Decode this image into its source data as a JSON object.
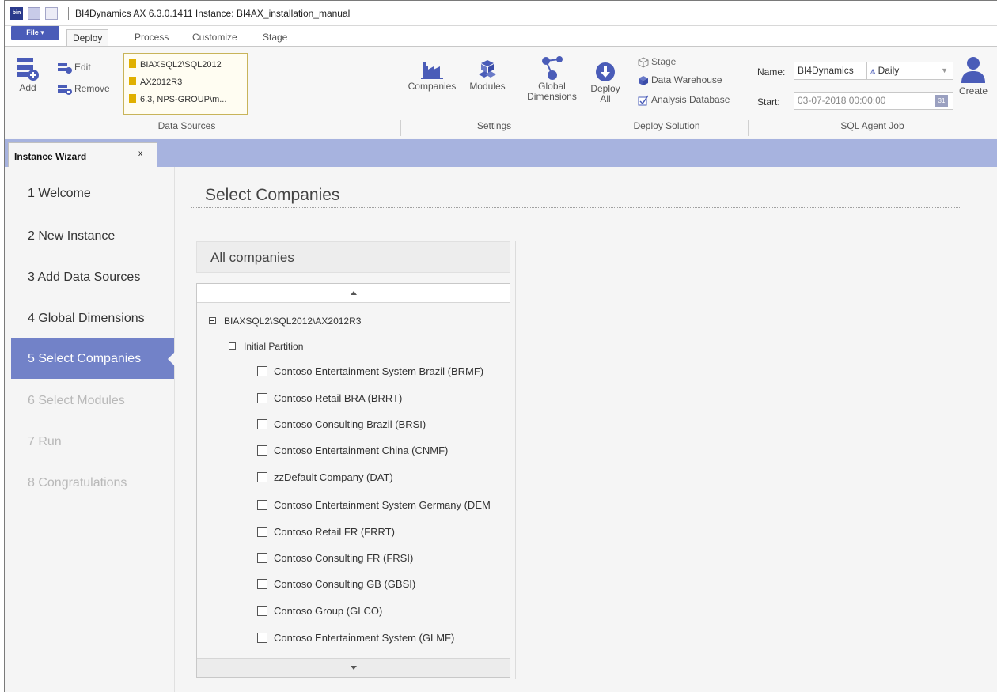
{
  "titlebar": {
    "title": "BI4Dynamics AX 6.3.0.1411  Instance: BI4AX_installation_manual",
    "app_icon_text": "bin"
  },
  "ribbon_tabs": {
    "file": "File ▾",
    "tabs": [
      {
        "label": "Deploy",
        "active": true
      },
      {
        "label": "Process"
      },
      {
        "label": "Customize"
      },
      {
        "label": "Stage"
      }
    ]
  },
  "ribbon": {
    "data_sources": {
      "add": "Add",
      "edit": "Edit",
      "remove": "Remove",
      "items": [
        "BIAXSQL2\\SQL2012",
        "AX2012R3",
        "6.3, NPS-GROUP\\m..."
      ],
      "group_label": "Data Sources"
    },
    "settings": {
      "companies": "Companies",
      "modules": "Modules",
      "global_dimensions_1": "Global",
      "global_dimensions_2": "Dimensions",
      "group_label": "Settings"
    },
    "deploy_solution": {
      "deploy_all_1": "Deploy",
      "deploy_all_2": "All",
      "stage": "Stage",
      "data_warehouse": "Data Warehouse",
      "analysis_database": "Analysis Database",
      "group_label": "Deploy Solution"
    },
    "sql_agent_job": {
      "name_label": "Name:",
      "name_value": "BI4Dynamics",
      "frequency": "Daily",
      "start_label": "Start:",
      "start_value": "03-07-2018 00:00:00",
      "calendar_day": "31",
      "create": "Create",
      "group_label": "SQL Agent Job"
    }
  },
  "doc_tab": {
    "label": "Instance Wizard",
    "close": "x"
  },
  "wizard_steps": [
    {
      "label": "1  Welcome",
      "state": "normal"
    },
    {
      "label": "2  New Instance",
      "state": "normal"
    },
    {
      "label": "3  Add Data Sources",
      "state": "normal"
    },
    {
      "label": "4  Global Dimensions",
      "state": "normal"
    },
    {
      "label": "5  Select Companies",
      "state": "active"
    },
    {
      "label": "6  Select Modules",
      "state": "disabled"
    },
    {
      "label": "7  Run",
      "state": "disabled"
    },
    {
      "label": "8  Congratulations",
      "state": "disabled"
    }
  ],
  "main": {
    "title": "Select Companies",
    "panel_header": "All companies",
    "tree_root": "BIAXSQL2\\SQL2012\\AX2012R3",
    "partition": "Initial Partition",
    "companies": [
      {
        "label": "Contoso Entertainment System Brazil (BRMF)",
        "checked": false
      },
      {
        "label": "Contoso Retail BRA (BRRT)",
        "checked": false
      },
      {
        "label": "Contoso Consulting Brazil (BRSI)",
        "checked": false
      },
      {
        "label": "Contoso Entertainment China (CNMF)",
        "checked": false
      },
      {
        "label": "zzDefault Company (DAT)",
        "checked": false
      },
      {
        "label": "Contoso Entertainment System Germany (DEM",
        "checked": false
      },
      {
        "label": "Contoso Retail FR (FRRT)",
        "checked": false
      },
      {
        "label": "Contoso Consulting FR (FRSI)",
        "checked": false
      },
      {
        "label": "Contoso Consulting GB (GBSI)",
        "checked": false
      },
      {
        "label": "Contoso Group (GLCO)",
        "checked": false
      },
      {
        "label": "Contoso Entertainment System (GLMF)",
        "checked": false
      }
    ]
  },
  "colors": {
    "accent": "#7282c8",
    "doc_tab_strip": "#a7b3df",
    "file_button": "#4a5cb8"
  }
}
